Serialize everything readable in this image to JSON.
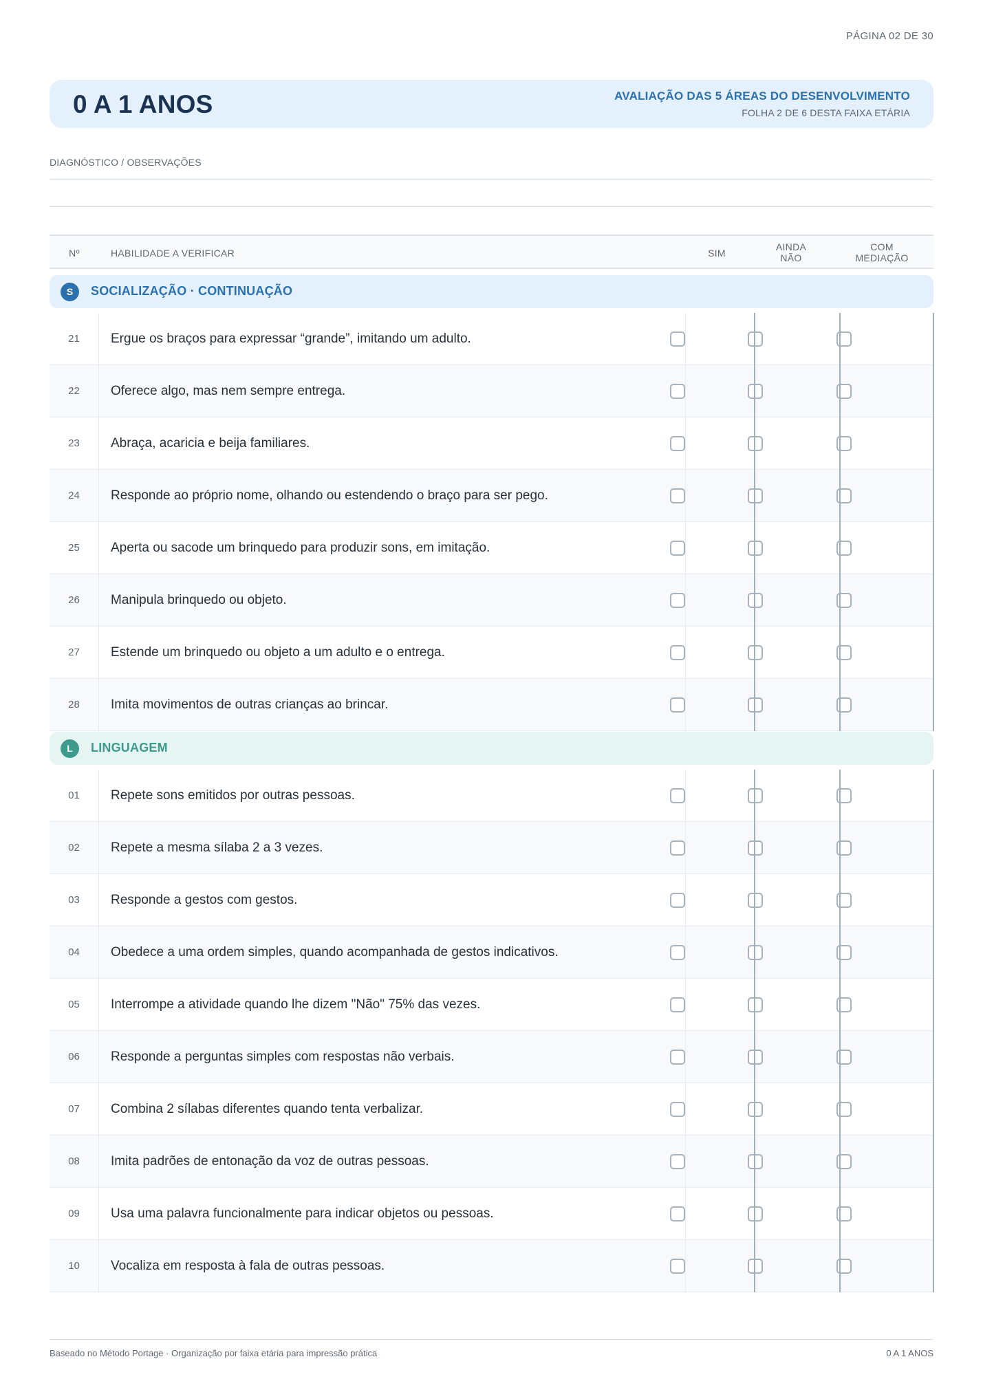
{
  "page": {
    "indicator": "PÁGINA 02 DE 30"
  },
  "header": {
    "title": "0 A 1 ANOS",
    "subtitle": "AVALIAÇÃO DAS 5 ÁREAS DO DESENVOLVIMENTO",
    "sheet": "FOLHA 2 DE 6 DESTA FAIXA ETÁRIA"
  },
  "diagnostics": {
    "label": "DIAGNÓSTICO / OBSERVAÇÕES"
  },
  "table": {
    "headers": {
      "number": "Nº",
      "skill": "HABILIDADE A VERIFICAR",
      "yes": "SIM",
      "not_yet_1": "AINDA",
      "not_yet_2": "NÃO",
      "mediation_1": "COM",
      "mediation_2": "MEDIAÇÃO"
    }
  },
  "colors": {
    "socialization_bar": "#e4f0fb",
    "socialization_accent": "#2b71ae",
    "language_bar": "#e6f5f1",
    "language_accent": "#3e9a8c"
  },
  "sections": [
    {
      "badge": "S",
      "title": "SOCIALIZAÇÃO · CONTINUAÇÃO",
      "items": [
        {
          "num": "21",
          "text": "Ergue os braços para expressar “grande”, imitando um adulto."
        },
        {
          "num": "22",
          "text": "Oferece algo, mas nem sempre entrega."
        },
        {
          "num": "23",
          "text": "Abraça, acaricia e beija familiares."
        },
        {
          "num": "24",
          "text": "Responde ao próprio nome, olhando ou estendendo o braço para ser pego."
        },
        {
          "num": "25",
          "text": "Aperta ou sacode um brinquedo para produzir sons, em imitação."
        },
        {
          "num": "26",
          "text": "Manipula brinquedo ou objeto."
        },
        {
          "num": "27",
          "text": "Estende um brinquedo ou objeto a um adulto e o entrega."
        },
        {
          "num": "28",
          "text": "Imita movimentos de outras crianças ao brincar."
        }
      ]
    },
    {
      "badge": "L",
      "title": "LINGUAGEM",
      "items": [
        {
          "num": "01",
          "text": "Repete sons emitidos por outras pessoas."
        },
        {
          "num": "02",
          "text": "Repete a mesma sílaba 2 a 3 vezes."
        },
        {
          "num": "03",
          "text": "Responde a gestos com gestos."
        },
        {
          "num": "04",
          "text": "Obedece a uma ordem simples, quando acompanhada de gestos indicativos."
        },
        {
          "num": "05",
          "text": "Interrompe a atividade quando lhe dizem \"Não\" 75% das vezes."
        },
        {
          "num": "06",
          "text": "Responde a perguntas simples com respostas não verbais."
        },
        {
          "num": "07",
          "text": "Combina 2 sílabas diferentes quando tenta verbalizar."
        },
        {
          "num": "08",
          "text": "Imita padrões de entonação da voz de outras pessoas."
        },
        {
          "num": "09",
          "text": "Usa uma palavra funcionalmente para indicar objetos ou pessoas."
        },
        {
          "num": "10",
          "text": "Vocaliza em resposta à fala de outras pessoas."
        }
      ]
    }
  ],
  "footer": {
    "left": "Baseado no Método Portage · Organização por faixa etária para impressão prática",
    "right": "0 A 1 ANOS"
  }
}
